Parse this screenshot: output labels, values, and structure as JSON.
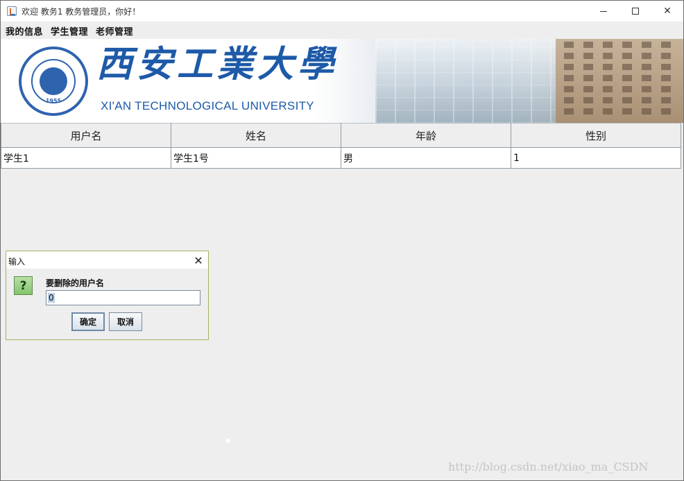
{
  "window": {
    "title": "欢迎 教务1 教务管理员，你好！",
    "minimize_label": "",
    "close_label": "✕"
  },
  "menu": {
    "items": [
      {
        "label": "我的信息"
      },
      {
        "label": "学生管理"
      },
      {
        "label": "老师管理"
      }
    ]
  },
  "banner": {
    "chinese_name": "西安工業大學",
    "english_name": "XI'AN TECHNOLOGICAL UNIVERSITY",
    "seal_year": "1955",
    "brand_color": "#1d5aa8"
  },
  "table": {
    "headers": [
      "用户名",
      "姓名",
      "年龄",
      "性别"
    ],
    "rows": [
      [
        "学生1",
        "学生1号",
        "男",
        "1"
      ]
    ]
  },
  "dialog": {
    "title": "输入",
    "close_label": "✕",
    "icon_text": "?",
    "prompt": "要删除的用户名",
    "input_value": "0",
    "ok_label": "确定",
    "cancel_label": "取消"
  },
  "watermark": "http://blog.csdn.net/xiao_ma_CSDN"
}
